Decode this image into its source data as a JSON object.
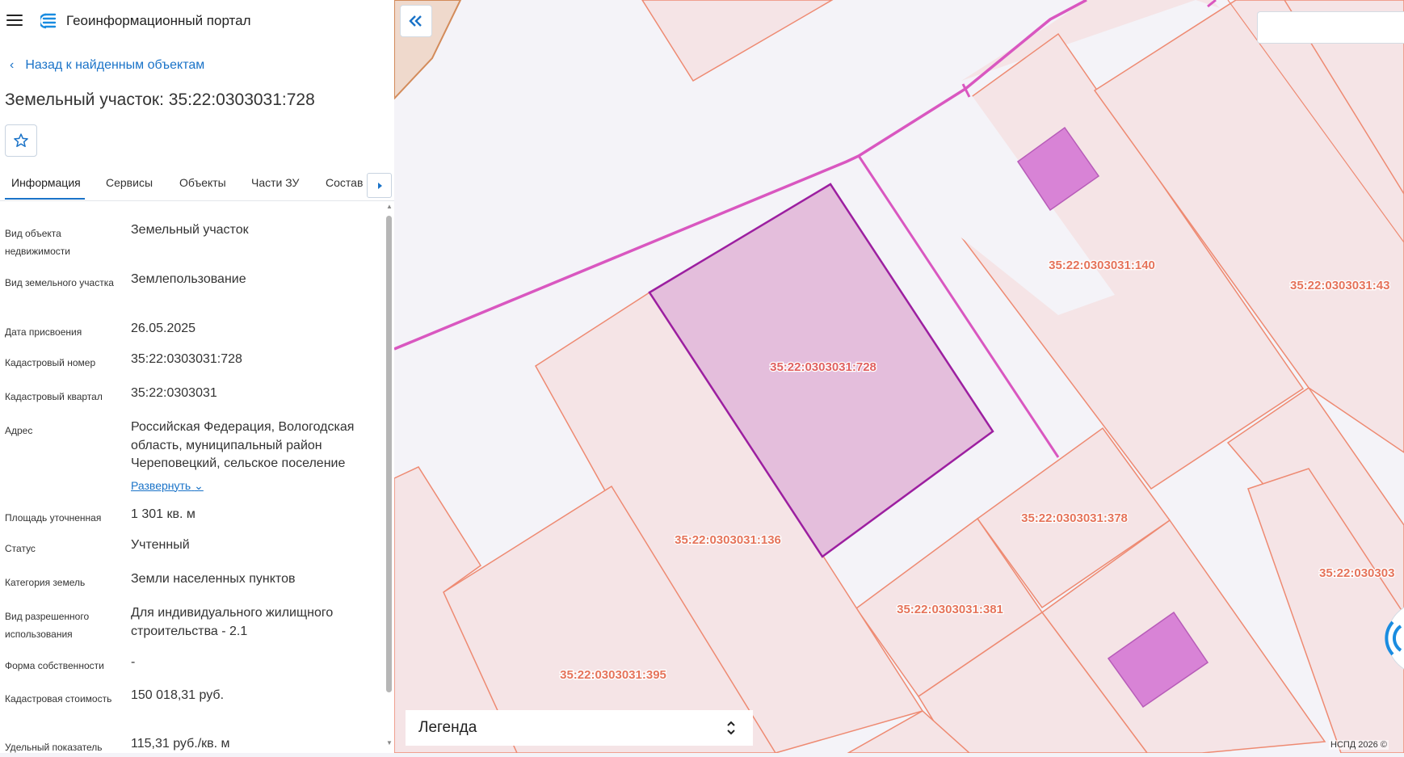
{
  "header": {
    "app_title": "Геоинформационный портал"
  },
  "navigation": {
    "back_label": "Назад к найденным объектам"
  },
  "object": {
    "title": "Земельный участок: 35:22:0303031:728"
  },
  "tabs": [
    {
      "label": "Информация",
      "active": true
    },
    {
      "label": "Сервисы",
      "active": false
    },
    {
      "label": "Объекты",
      "active": false
    },
    {
      "label": "Части ЗУ",
      "active": false
    },
    {
      "label": "Состав",
      "active": false
    }
  ],
  "properties": [
    {
      "label": "Вид объекта недвижимости",
      "value": "Земельный участок"
    },
    {
      "label": "Вид земельного участка",
      "value": "Землепользование"
    },
    {
      "label": "Дата присвоения",
      "value": "26.05.2025"
    },
    {
      "label": "Кадастровый номер",
      "value": "35:22:0303031:728"
    },
    {
      "label": "Кадастровый квартал",
      "value": "35:22:0303031"
    },
    {
      "label": "Адрес",
      "value": "Российская Федерация, Вологодская область, муниципальный район Череповецкий, сельское поселение",
      "expand_label": "Развернуть"
    },
    {
      "label": "Площадь уточненная",
      "value": "1 301 кв. м"
    },
    {
      "label": "Статус",
      "value": "Учтенный"
    },
    {
      "label": "Категория земель",
      "value": "Земли населенных пунктов"
    },
    {
      "label": "Вид разрешенного использования",
      "value": "Для индивидуального жилищного строительства - 2.1"
    },
    {
      "label": "Форма собственности",
      "value": "-"
    },
    {
      "label": "Кадастровая стоимость",
      "value": "150 018,31 руб."
    },
    {
      "label": "Удельный показатель",
      "value": "115,31 руб./кв. м"
    }
  ],
  "map": {
    "parcel_labels": [
      "35:22:0303031:728",
      "35:22:0303031:140",
      "35:22:0303031:43",
      "35:22:0303031:136",
      "35:22:0303031:378",
      "35:22:0303031:381",
      "35:22:0303031:395",
      "35:22:030303"
    ],
    "legend_label": "Легенда",
    "copyright": "НСПД 2026 ©",
    "colors": {
      "parcel_fill": "#f5e4e6",
      "parcel_stroke": "#ee8a72",
      "selected_fill": "#e4bedc",
      "selected_stroke": "#9c1fa0",
      "boundary_line": "#d957c0",
      "building_fill": "#d883d6",
      "background": "#f4f3f8",
      "accent": "#1a73c8"
    }
  }
}
